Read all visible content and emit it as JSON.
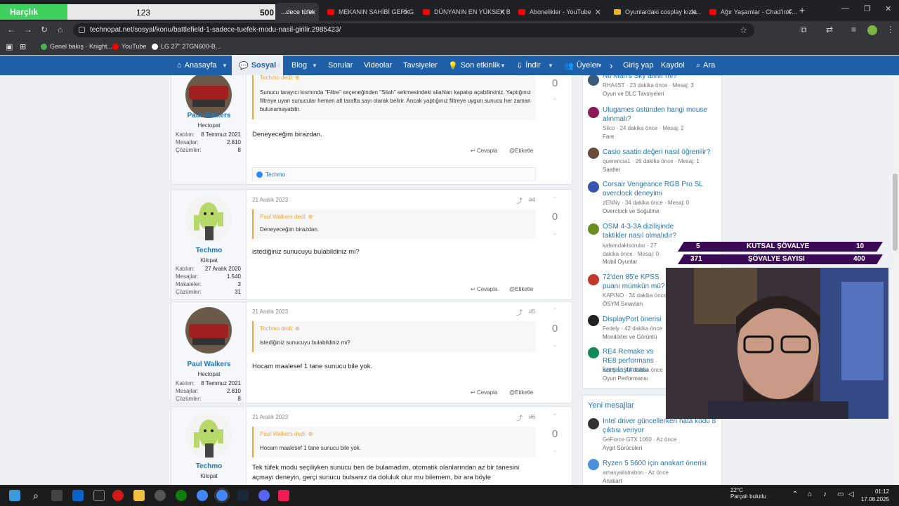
{
  "overlay": {
    "counter_label": "Harçlık",
    "counter_value": "123",
    "counter_max": "500",
    "progress_fraction": 0.246,
    "knights": [
      {
        "left": "5",
        "label": "KUTSAL ŞÖVALYE",
        "right": "10"
      },
      {
        "left": "371",
        "label": "ŞÖVALYE SAYISI",
        "right": "400"
      }
    ]
  },
  "browser": {
    "tabs": [
      {
        "label": "...dece tüfek",
        "color": "#4a90d9"
      },
      {
        "label": "MEKANIN SAHİBİ GERİ G...",
        "color": "#ff0000"
      },
      {
        "label": "DÜNYANIN EN YÜKSEK B...",
        "color": "#ff0000"
      },
      {
        "label": "Abonelikler - YouTube",
        "color": "#ff0000"
      },
      {
        "label": "Oyunlardaki cosplay kızla...",
        "color": "#e8b829"
      },
      {
        "label": "Ağır Yaşamlar - Chad'in F...",
        "color": "#ff0000"
      }
    ],
    "url": "technopat.net/sosyal/konu/battlefield-1-sadece-tuefek-modu-nasil-girilir.2985423/",
    "bookmarks": [
      "Genel bakış · Knight...",
      "YouTube",
      "LG 27\" 27GN600-B..."
    ]
  },
  "nav": {
    "items": [
      "Anasayfa",
      "Sosyal",
      "Blog",
      "Sorular",
      "Videolar",
      "Tavsiyeler",
      "Son etkinlik",
      "İndir",
      "Üyeler"
    ],
    "login": "Giriş yap",
    "register": "Kaydol",
    "search": "Ara"
  },
  "labels": {
    "joined": "Katılım:",
    "messages": "Mesajlar:",
    "solutions": "Çözümler:",
    "articles": "Makaleler:",
    "reply": "Cevapla",
    "tag": "Etiketle"
  },
  "posts": [
    {
      "user": "Paul Walkers",
      "rank": "Hectopat",
      "joined": "8 Temmuz 2021",
      "messages": "2.810",
      "solutions": "8",
      "quote_author": "Techmo dedi:",
      "quote": "Sunucu tarayıcı kısmında \"Filtre\" seçeneğinden \"Silah\" sekmesindeki silahları kapatıp açabilirsiniz. Yaptığınız filtreye uyan sunucular hemen alt tarafta sayı olarak belirir. Ancak yaptığınız filtreye uygun sunucu her zaman bulunamayabilir.",
      "message": "Deneyeceğim birazdan.",
      "votes": "0",
      "reaction": "Techmo"
    },
    {
      "date": "21 Aralık 2023",
      "num": "#4",
      "user": "Techmo",
      "rank": "Kilopat",
      "joined": "27 Aralık 2020",
      "messages": "1.540",
      "articles": "3",
      "solutions": "31",
      "quote_author": "Paul Walkers dedi:",
      "quote": "Deneyeceğim birazdan.",
      "message": "istediğiniz sunucuyu bulabildiniz mi?",
      "votes": "0"
    },
    {
      "date": "21 Aralık 2023",
      "num": "#5",
      "user": "Paul Walkers",
      "rank": "Hectopat",
      "joined": "8 Temmuz 2021",
      "messages": "2.810",
      "solutions": "8",
      "quote_author": "Techmo dedi:",
      "quote": "istediğiniz sunucuyu bulabildiniz mi?",
      "message": "Hocam maalesef 1 tane sunucu bile yok.",
      "votes": "0"
    },
    {
      "date": "21 Aralık 2023",
      "num": "#6",
      "user": "Techmo",
      "rank": "Kilopat",
      "quote_author": "Paul Walkers dedi:",
      "quote": "Hocam maalesef 1 tane sunucu bile yok.",
      "message": "Tek tüfek modu seçiliyken sunucu ben de bulamadım, otomatik olanlarından az bir tanesini açmayı deneyin, gerçi sunucu bulsanız da doluluk olur mu bilemem, bir ara böyle",
      "votes": "0"
    }
  ],
  "sidebar": {
    "threads": [
      {
        "title": "No Man's Sky alınır mı?",
        "meta": "RHA4ST · 23 dakika önce · Mesaj: 3",
        "forum": "Oyun ve DLC Tavsiyeleri",
        "color": "#3a5a7a"
      },
      {
        "title": "Ulugames üstünden hangi mouse alınmalı?",
        "meta": "Silco · 24 dakika önce · Mesaj: 2",
        "forum": "Fare",
        "color": "#8a1a5a"
      },
      {
        "title": "Casio saatin değeri nasıl öğrenilir?",
        "meta": "querencia1 · 26 dakika önce · Mesaj: 1",
        "forum": "Saatler",
        "color": "#6a4a3a"
      },
      {
        "title": "Corsair Vengeance RGB Pro SL overclock deneyimi",
        "meta": "zENNy · 34 dakika önce · Mesaj: 0",
        "forum": "Overclock ve Soğutma",
        "color": "#3a55b0"
      },
      {
        "title": "OSM 4-3-3A dizilişinde taktikler nasıl olmalıdır?",
        "meta": "kafamdakisorular · 27 dakika önce · Mesaj: 0",
        "forum": "Mobil Oyunlar",
        "color": "#6b8e23"
      },
      {
        "title": "72'den 85'e KPSS puanı mümkün mü?",
        "meta": "KAPINO · 34 dakika önce",
        "forum": "ÖSYM Sınavları",
        "color": "#c0392b"
      },
      {
        "title": "DisplayPort önerisi",
        "meta": "Fedely · 42 dakika önce",
        "forum": "Monitörler ve Görüntü",
        "color": "#222222"
      },
      {
        "title": "RE4 Remake vs RE8 performans karşılaştırması",
        "meta": "sezmis · 44 dakika önce",
        "forum": "Oyun Performansı",
        "color": "#138a5a"
      }
    ],
    "new_messages_title": "Yeni mesajlar",
    "new_messages": [
      {
        "title": "Intel driver güncellerken hata kodu 8 çıktısı veriyor",
        "meta": "GeForce GTX 1060 · Az önce",
        "forum": "Aygıt Sürücüleri",
        "color": "#333333"
      },
      {
        "title": "Ryzen 5 5600 için anakart önerisi",
        "meta": "amasyalistrabon · Az önce",
        "forum": "Anakart",
        "color": "#4a90d9"
      }
    ]
  },
  "taskbar": {
    "temp": "22°C",
    "weather": "Parçalı bulutlu",
    "time": "01:12",
    "date": "17.08.2025"
  },
  "colors": {
    "accent": "#1f5fa8",
    "link": "#2577b1",
    "quote": "#e8a63a"
  }
}
